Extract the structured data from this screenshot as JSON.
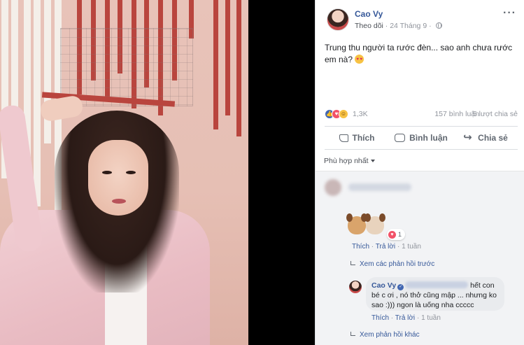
{
  "post": {
    "author": "Cao Vy",
    "follow_label": "Theo dõi",
    "date": "24 Tháng 9",
    "more": "···",
    "status_text": "Trung thu người ta rước đèn... sao anh chưa rước em nà?",
    "reaction_count": "1,3K",
    "comment_count": "157 bình luận",
    "share_count": "5 lượt chia sẻ",
    "actions": {
      "like": "Thích",
      "comment": "Bình luận",
      "share": "Chia sẻ"
    }
  },
  "comments": {
    "sort_label": "Phù hợp nhất",
    "first": {
      "sticker_reaction_count": "1",
      "like": "Thích",
      "reply": "Trả lời",
      "sep": "·",
      "time": "1 tuần"
    },
    "view_previous_replies": "Xem các phản hồi trước",
    "reply": {
      "author": "Cao Vy",
      "text_line1": "hết con",
      "text_rest": "bé c ơi , nó thở cũng mập ... nhưng ko sao :))) ngon là uống nha ccccc",
      "like": "Thích",
      "reply": "Trả lời",
      "sep": "·",
      "time": "1 tuần"
    },
    "view_other_replies": "Xem phản hồi khác"
  },
  "icons": {
    "globe": "globe-icon",
    "like": "like-icon",
    "comment": "comment-icon",
    "share": "share-icon",
    "react_like": "like-reaction-icon",
    "react_love": "love-reaction-icon",
    "react_haha": "haha-reaction-icon"
  },
  "colors": {
    "link": "#365899",
    "muted": "#90949c",
    "like_blue": "#4267b2",
    "love_red": "#f25268",
    "haha_yellow": "#f7c244"
  }
}
